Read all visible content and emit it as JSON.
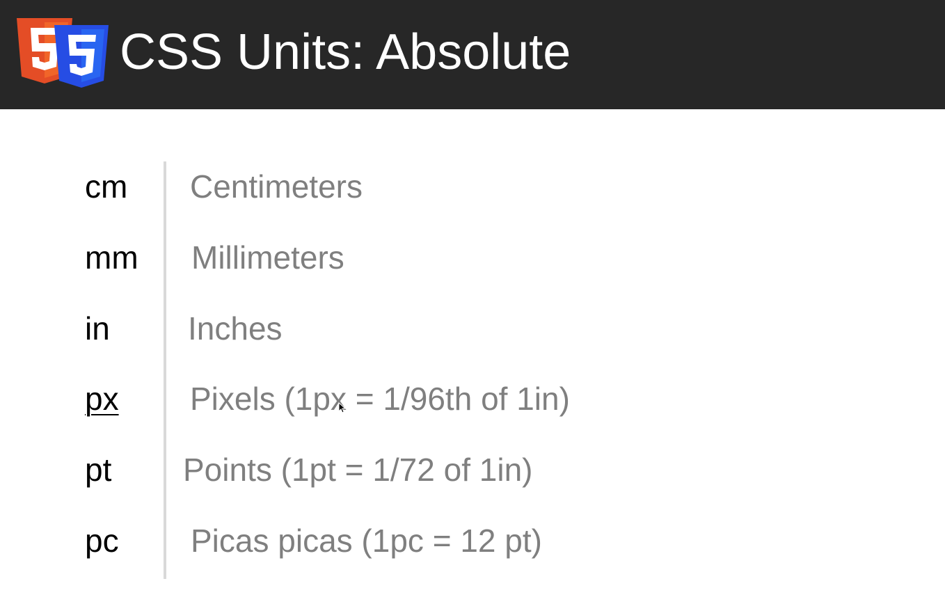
{
  "header": {
    "title": "CSS Units: Absolute",
    "logo_icon": "html5-css3-logo-icon",
    "background_color": "#272727"
  },
  "units": [
    {
      "unit": "cm",
      "description": "Centimeters"
    },
    {
      "unit": "mm",
      "description": "Millimeters"
    },
    {
      "unit": "in",
      "description": "Inches"
    },
    {
      "unit": "px",
      "description": "Pixels (1px = 1/96th of 1in)"
    },
    {
      "unit": "pt",
      "description": "Points (1pt = 1/72 of 1in)"
    },
    {
      "unit": "pc",
      "description": "Picas picas (1pc = 12 pt)"
    }
  ],
  "colors": {
    "unit_text": "#000000",
    "description_text": "#7f7f7f",
    "divider": "#d9d9d9"
  }
}
